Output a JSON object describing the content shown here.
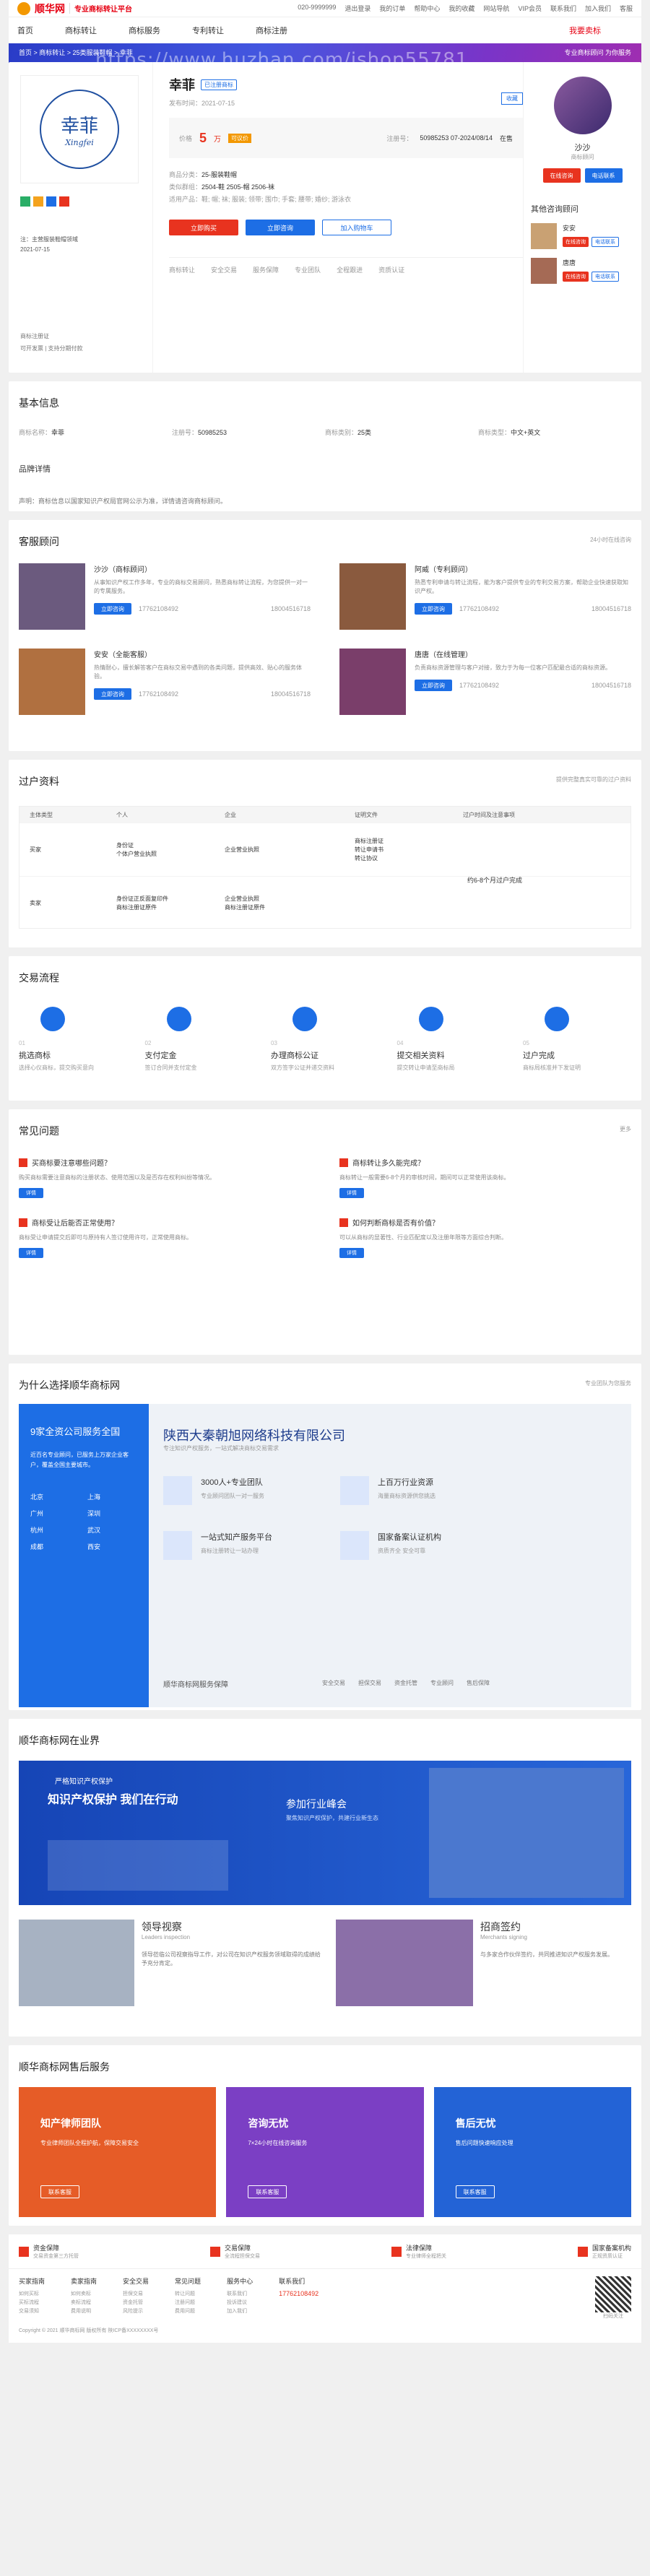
{
  "topbar": {
    "logo": "顺华网",
    "logo_sub": "专业商标转让平台",
    "links": [
      "020-9999999",
      "退出登录",
      "我的订单",
      "帮助中心",
      "我的收藏",
      "网站导航",
      "VIP会员",
      "联系我们",
      "加入我们",
      "客服"
    ]
  },
  "nav": {
    "items": [
      "首页",
      "商标转让",
      "商标服务",
      "专利转让",
      "商标注册"
    ],
    "right": "我要卖标"
  },
  "banner": {
    "watermark": "https://www.huzhan.com/ishop55781",
    "crumb": "首页 > 商标转让 > 25类服装鞋帽 > 幸菲",
    "right": "专业商标顾问 为你服务"
  },
  "product": {
    "logo_cn": "幸菲",
    "logo_en": "Xingfei",
    "name": "幸菲",
    "tag": "已注册商标",
    "date": "发布时间：2021-07-15",
    "collect": "收藏",
    "price_label": "价格",
    "price": "5",
    "price_unit": "万",
    "price_tag": "可议价",
    "reg_no_label": "注册号：",
    "reg_no": "50985253  07-2024/08/14",
    "status": "在售",
    "cls_label": "商品分类：",
    "cls": "25-服装鞋帽",
    "group_label": "类似群组：",
    "group": "2504-鞋 2505-帽 2506-袜",
    "svc_label": "适用产品：",
    "svc": "鞋; 帽; 袜; 服装; 领带; 围巾; 手套; 腰带; 婚纱; 游泳衣",
    "btn_buy": "立即购买",
    "btn_consult": "立即咨询",
    "btn_cart": "加入购物车",
    "features": [
      "商标转让",
      "安全交易",
      "服务保障",
      "专业团队",
      "全程跟进",
      "资质认证"
    ],
    "left_tag": "商标注册证",
    "left_note": "注：主营服装鞋帽领域",
    "left_date": "2021-07-15",
    "left_bottom": "可开发票 | 支持分期付款"
  },
  "consultant": {
    "name": "沙沙",
    "title": "商标顾问",
    "btn_chat": "在线咨询",
    "btn_phone": "电话联系",
    "other": "其他咨询顾问",
    "others": [
      {
        "name": "安安",
        "b1": "在线咨询",
        "b2": "电话联系"
      },
      {
        "name": "唐唐",
        "b1": "在线咨询",
        "b2": "电话联系"
      }
    ]
  },
  "info": {
    "title": "基本信息",
    "fields": [
      {
        "k": "商标名称：",
        "v": "幸菲"
      },
      {
        "k": "注册号：",
        "v": "50985253"
      },
      {
        "k": "商标类别：",
        "v": "25类"
      },
      {
        "k": "商标类型：",
        "v": "中文+英文"
      }
    ],
    "sub": "品牌详情",
    "desc": "声明：商标信息以国家知识产权局官网公示为准，详情请咨询商标顾问。"
  },
  "advisors": {
    "title": "客服顾问",
    "more": "24小时在线咨询",
    "list": [
      {
        "name": "沙沙（商标顾问）",
        "desc": "从事知识产权工作多年，专业的商标交易顾问，熟悉商标转让流程，为您提供一对一的专属服务。",
        "btn": "立即咨询",
        "phone": "17762108492",
        "wx": "18004516718"
      },
      {
        "name": "阿威（专利顾问）",
        "desc": "熟悉专利申请与转让流程，能为客户提供专业的专利交易方案，帮助企业快速获取知识产权。",
        "btn": "立即咨询",
        "phone": "17762108492",
        "wx": "18004516718"
      },
      {
        "name": "安安（全能客服）",
        "desc": "热情耐心，擅长解答客户在商标交易中遇到的各类问题，提供高效、贴心的服务体验。",
        "btn": "立即咨询",
        "phone": "17762108492",
        "wx": "18004516718"
      },
      {
        "name": "唐唐（在线管理）",
        "desc": "负责商标资源管理与客户对接，致力于为每一位客户匹配最合适的商标资源。",
        "btn": "立即咨询",
        "phone": "17762108492",
        "wx": "18004516718"
      }
    ]
  },
  "transfer": {
    "title": "过户资料",
    "note": "提供完整真实可靠的过户资料",
    "heads": [
      "主体类型",
      "个人",
      "企业",
      "证明文件",
      "过户时间及注意事项"
    ],
    "rows": [
      {
        "type": "买家",
        "p": "身份证\n个体户营业执照",
        "c": "企业营业执照",
        "d": "商标注册证\n转让申请书\n转让协议"
      },
      {
        "type": "卖家",
        "p": "身份证正反面复印件\n商标注册证原件",
        "c": "企业营业执照\n商标注册证原件",
        "d": ""
      }
    ],
    "time": "约6-8个月过户完成"
  },
  "process": {
    "title": "交易流程",
    "steps": [
      {
        "n": "01",
        "t": "挑选商标",
        "d": "选择心仪商标，提交购买意向"
      },
      {
        "n": "02",
        "t": "支付定金",
        "d": "签订合同并支付定金"
      },
      {
        "n": "03",
        "t": "办理商标公证",
        "d": "双方签字公证并递交资料"
      },
      {
        "n": "04",
        "t": "提交相关资料",
        "d": "提交转让申请至商标局"
      },
      {
        "n": "05",
        "t": "过户完成",
        "d": "商标局核准并下发证明"
      }
    ]
  },
  "faq": {
    "title": "常见问题",
    "more": "更多",
    "list": [
      {
        "q": "买商标要注意哪些问题？",
        "a": "购买商标需要注意商标的注册状态、使用范围以及是否存在权利纠纷等情况。",
        "btn": "详情"
      },
      {
        "q": "商标转让多久能完成？",
        "a": "商标转让一般需要6-8个月的审核时间，期间可以正常使用该商标。",
        "btn": "详情"
      },
      {
        "q": "商标受让后能否正常使用？",
        "a": "商标受让申请提交后即可与原持有人签订使用许可，正常使用商标。",
        "btn": "详情"
      },
      {
        "q": "如何判断商标是否有价值？",
        "a": "可以从商标的显著性、行业匹配度以及注册年限等方面综合判断。",
        "btn": "详情"
      }
    ]
  },
  "why": {
    "title": "为什么选择顺华商标网",
    "more": "专业团队为您服务",
    "blue_title": "9家全资公司服务全国",
    "blue_desc": "近百名专业顾问，已服务上万家企业客户，覆盖全国主要城市。",
    "cities": [
      "北京",
      "上海",
      "广州",
      "深圳",
      "杭州",
      "武汉",
      "成都",
      "西安"
    ],
    "company": "陕西大秦朝旭网络科技有限公司",
    "company_sub": "专注知识产权服务，一站式解决商标交易需求",
    "items": [
      {
        "t": "3000人+专业团队",
        "d": "专业顾问团队一对一服务"
      },
      {
        "t": "上百万行业资源",
        "d": "海量商标资源供您挑选"
      },
      {
        "t": "一站式知产服务平台",
        "d": "商标注册转让一站办理"
      },
      {
        "t": "国家备案认证机构",
        "d": "资质齐全 安全可靠"
      }
    ],
    "foot": "顺华商标网服务保障",
    "foot_items": [
      "安全交易",
      "担保交易",
      "资金托管",
      "专业顾问",
      "售后保障"
    ]
  },
  "news": {
    "title": "顺华商标网在业界",
    "banner_t1": "严格知识产权保护",
    "banner_t2": "知识产权保护 我们在行动",
    "banner_r": "参加行业峰会",
    "banner_r_sub": "聚焦知识产权保护，共建行业新生态",
    "b1": "领导视察",
    "b1_sub": "Leaders inspection",
    "b1_d": "领导莅临公司视察指导工作，对公司在知识产权服务领域取得的成绩给予充分肯定。",
    "b2": "招商签约",
    "b2_sub": "Merchants signing",
    "b2_d": "与多家合作伙伴签约，共同推进知识产权服务发展。"
  },
  "after": {
    "title": "顺华商标网售后服务",
    "list": [
      {
        "t": "知产律师团队",
        "d": "专业律师团队全程护航，保障交易安全",
        "btn": "联系客服"
      },
      {
        "t": "咨询无忧",
        "d": "7×24小时在线咨询服务",
        "btn": "联系客服"
      },
      {
        "t": "售后无忧",
        "d": "售后问题快速响应处理",
        "btn": "联系客服"
      }
    ]
  },
  "footer": {
    "guar": [
      {
        "t": "资金保障",
        "d": "交易资金第三方托管"
      },
      {
        "t": "交易保障",
        "d": "全流程担保交易"
      },
      {
        "t": "法律保障",
        "d": "专业律师全程把关"
      },
      {
        "t": "国家备案机构",
        "d": "正规资质认证"
      }
    ],
    "cols": [
      {
        "h": "买家指南",
        "l": [
          "如何买标",
          "买标流程",
          "交易须知"
        ]
      },
      {
        "h": "卖家指南",
        "l": [
          "如何卖标",
          "卖标流程",
          "费用说明"
        ]
      },
      {
        "h": "安全交易",
        "l": [
          "担保交易",
          "资金托管",
          "风险提示"
        ]
      },
      {
        "h": "常见问题",
        "l": [
          "转让问题",
          "注册问题",
          "费用问题"
        ]
      },
      {
        "h": "服务中心",
        "l": [
          "联系我们",
          "投诉建议",
          "加入我们"
        ]
      }
    ],
    "contact": "联系我们",
    "tel": "17762108492",
    "qr": "扫码关注",
    "copy": "Copyright © 2021 顺华商标网 版权所有 陕ICP备XXXXXXXX号"
  }
}
